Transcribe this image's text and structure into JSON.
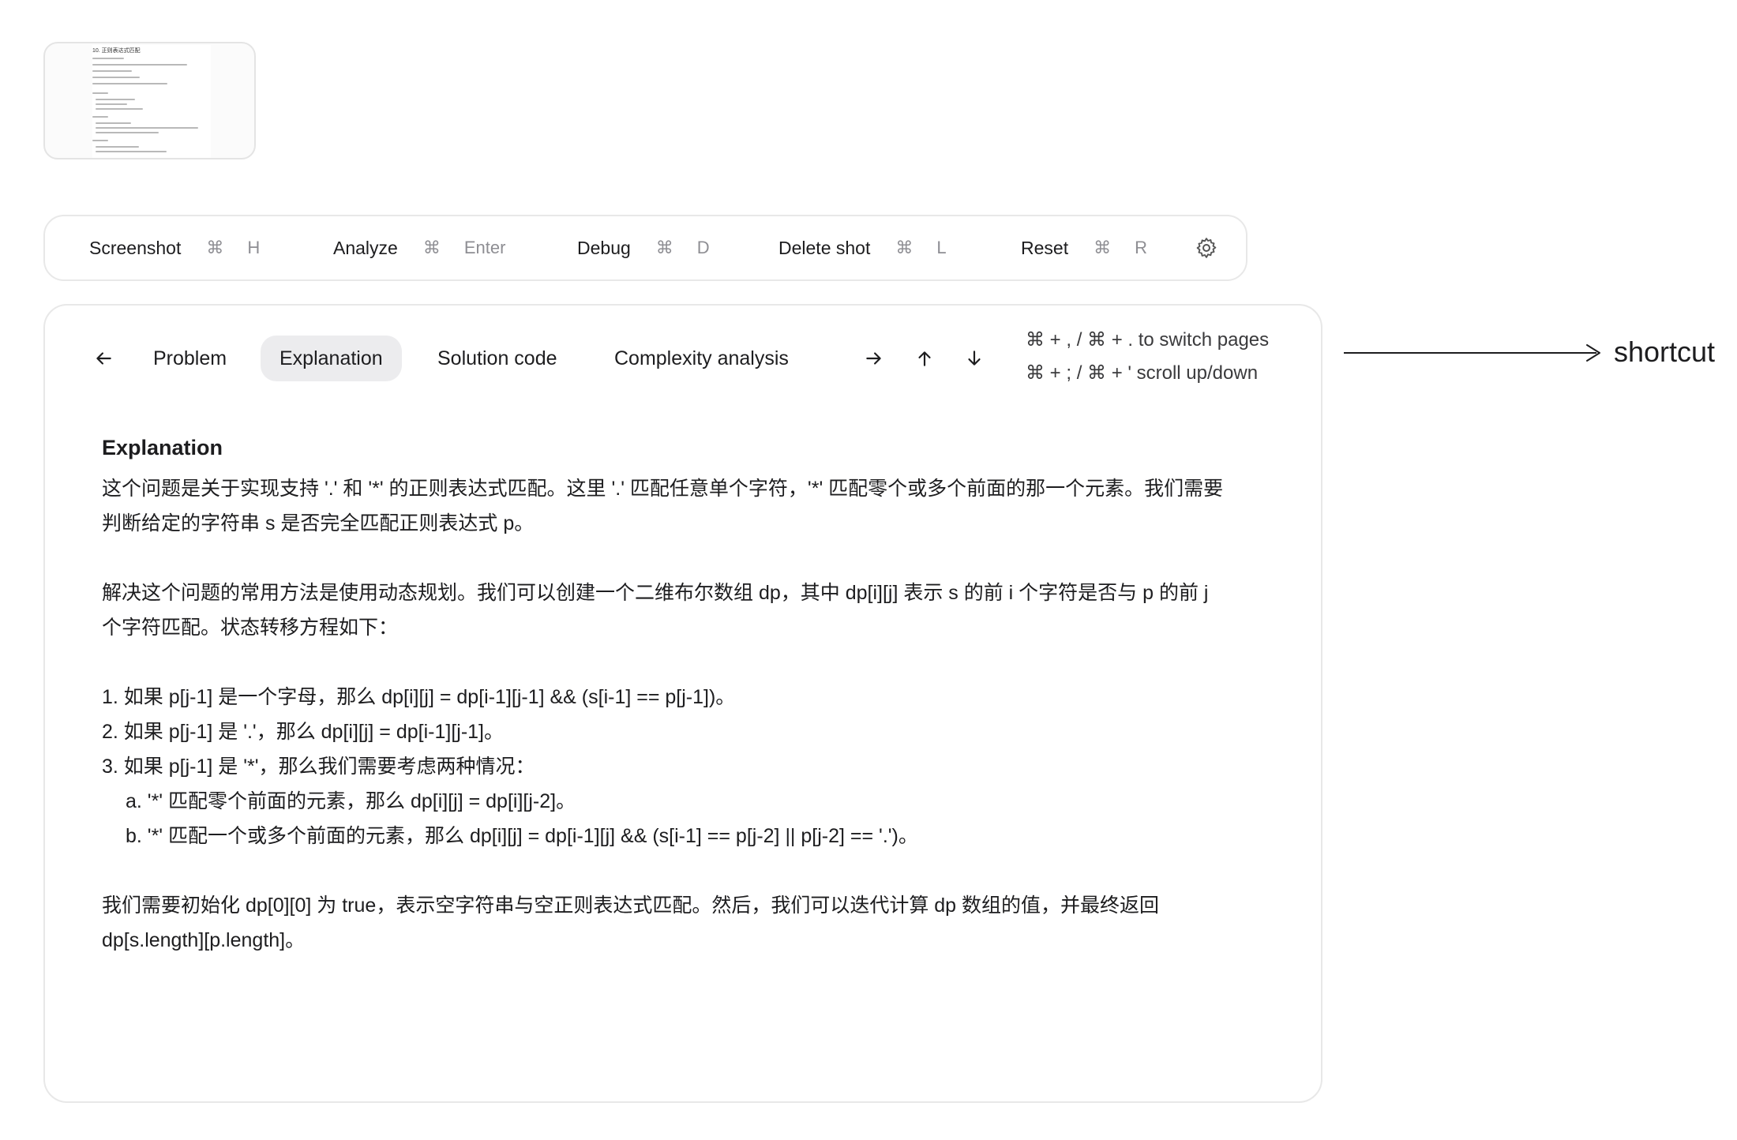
{
  "thumbnail": {
    "title": "10. 正则表达式匹配"
  },
  "toolbar": {
    "screenshot": {
      "label": "Screenshot",
      "key1": "⌘",
      "key2": "H"
    },
    "analyze": {
      "label": "Analyze",
      "key1": "⌘",
      "key2": "Enter"
    },
    "debug": {
      "label": "Debug",
      "key1": "⌘",
      "key2": "D"
    },
    "delete_shot": {
      "label": "Delete shot",
      "key1": "⌘",
      "key2": "L"
    },
    "reset": {
      "label": "Reset",
      "key1": "⌘",
      "key2": "R"
    },
    "settings_icon": "gear-icon"
  },
  "nav": {
    "back_icon": "arrow-left-icon",
    "tabs": [
      {
        "label": "Problem",
        "active": false
      },
      {
        "label": "Explanation",
        "active": true
      },
      {
        "label": "Solution code",
        "active": false
      },
      {
        "label": "Complexity analysis",
        "active": false
      }
    ],
    "forward_icon": "arrow-right-icon",
    "up_icon": "arrow-up-icon",
    "down_icon": "arrow-down-icon",
    "hint_pages": "⌘ + , / ⌘ + . to switch pages",
    "hint_scroll": "⌘ + ; / ⌘ + ' scroll up/down"
  },
  "explanation": {
    "title": "Explanation",
    "para1_line1": "这个问题是关于实现支持 '.' 和 '*' 的正则表达式匹配。这里 '.' 匹配任意单个字符，'*' 匹配零个或多个前面的那一个元素。我们需要",
    "para1_line2": "判断给定的字符串 s 是否完全匹配正则表达式 p。",
    "para2_line1": "解决这个问题的常用方法是使用动态规划。我们可以创建一个二维布尔数组 dp，其中 dp[i][j] 表示 s 的前 i 个字符是否与 p 的前 j",
    "para2_line2": "个字符匹配。状态转移方程如下：",
    "item1": "1. 如果 p[j-1] 是一个字母，那么 dp[i][j] = dp[i-1][j-1] && (s[i-1] == p[j-1])。",
    "item2": "2. 如果 p[j-1] 是 '.'，那么 dp[i][j] = dp[i-1][j-1]。",
    "item3": "3. 如果 p[j-1] 是 '*'，那么我们需要考虑两种情况：",
    "item3a": "a. '*' 匹配零个前面的元素，那么 dp[i][j] = dp[i][j-2]。",
    "item3b": "b. '*' 匹配一个或多个前面的元素，那么 dp[i][j] = dp[i-1][j] && (s[i-1] == p[j-2] || p[j-2] == '.')。",
    "para3_line1": "我们需要初始化 dp[0][0] 为 true，表示空字符串与空正则表达式匹配。然后，我们可以迭代计算 dp 数组的值，并最终返回",
    "para3_line2": "dp[s.length][p.length]。"
  },
  "annotation": {
    "label": "shortcut"
  }
}
